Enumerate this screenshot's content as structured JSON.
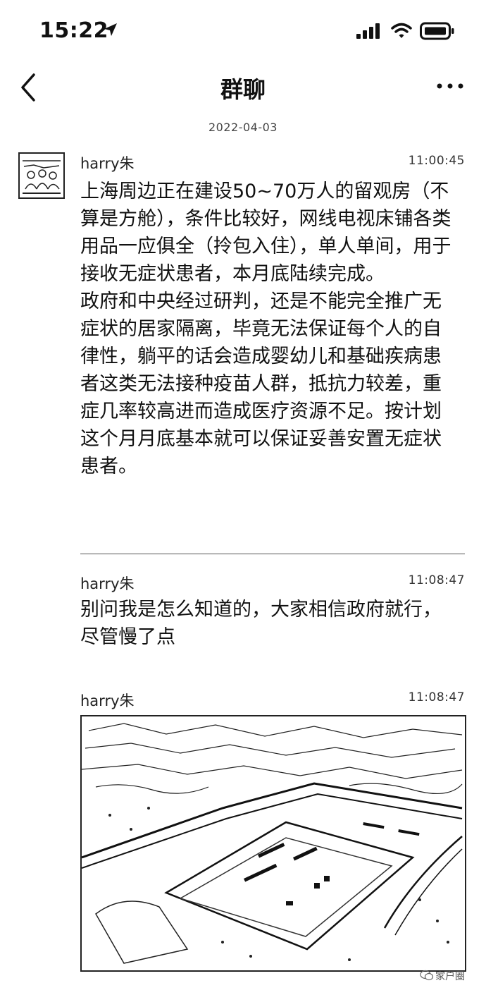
{
  "status_bar": {
    "time": "15:22"
  },
  "nav": {
    "title": "群聊"
  },
  "date_stamp": "2022-04-03",
  "messages": [
    {
      "sender": "harry朱",
      "time": "11:00:45",
      "text": "上海周边正在建设50~70万人的留观房（不算是方舱），条件比较好，网线电视床铺各类用品一应俱全（拎包入住），单人单间，用于接收无症状患者，本月底陆续完成。\n政府和中央经过研判，还是不能完全推广无症状的居家隔离，毕竟无法保证每个人的自律性，躺平的话会造成婴幼儿和基础疾病患者这类无法接种疫苗人群，抵抗力较差，重症几率较高进而造成医疗资源不足。按计划这个月月底基本就可以保证妥善安置无症状患者。"
    },
    {
      "sender": "harry朱",
      "time": "11:08:47",
      "text": "别问我是怎么知道的，大家相信政府就行，尽管慢了点"
    },
    {
      "sender": "harry朱",
      "time": "11:08:47",
      "image_desc_icon": "aerial-construction-photo"
    }
  ],
  "watermark": "家户圈"
}
